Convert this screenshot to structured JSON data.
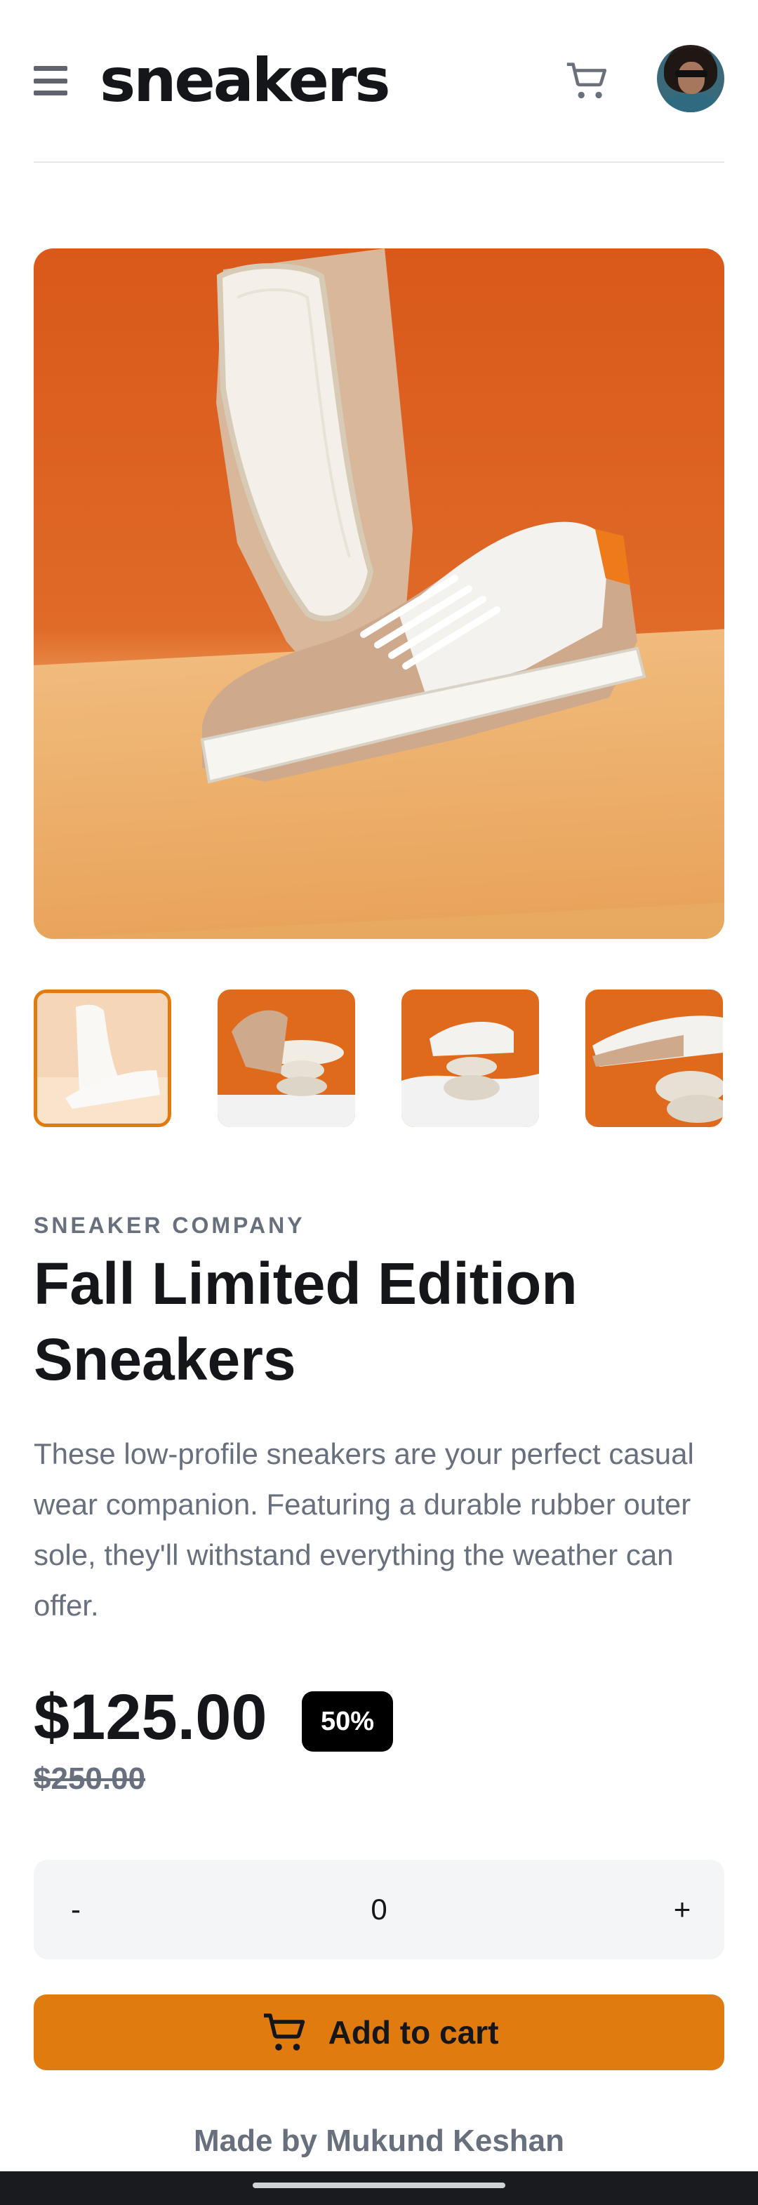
{
  "header": {
    "logo": "sneakers",
    "menu_icon": "menu-icon",
    "cart_icon": "cart-icon",
    "avatar": "avatar"
  },
  "gallery": {
    "thumbnails_count": 4,
    "active_index": 0
  },
  "product": {
    "company": "SNEAKER COMPANY",
    "title": "Fall Limited Edition Sneakers",
    "description": "These low-profile sneakers are your perfect casual wear companion. Featuring a durable rubber outer sole, they'll withstand everything the weather can offer.",
    "price": "$125.00",
    "discount": "50%",
    "old_price": "$250.00"
  },
  "quantity": {
    "minus": "-",
    "value": "0",
    "plus": "+"
  },
  "cart_button": {
    "label": "Add to cart"
  },
  "footer": {
    "credit": "Made by Mukund Keshan"
  },
  "colors": {
    "accent": "#e07b0f",
    "text_dark": "#15161a",
    "text_muted": "#68707d"
  }
}
